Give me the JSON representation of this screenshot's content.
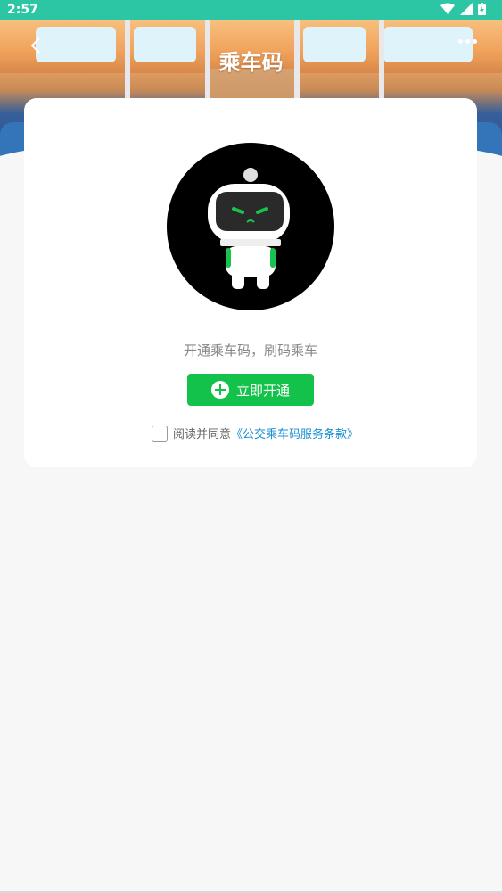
{
  "status_bar": {
    "time": "2:57"
  },
  "header": {
    "title": "乘车码"
  },
  "card": {
    "prompt": "开通乘车码，刷码乘车",
    "open_button_label": "立即开通",
    "agree_prefix": "阅读并同意",
    "terms_link": "《公交乘车码服务条款》"
  },
  "colors": {
    "status_bar": "#2dc6a4",
    "primary_button": "#12c24a",
    "link": "#1a8fd2"
  }
}
